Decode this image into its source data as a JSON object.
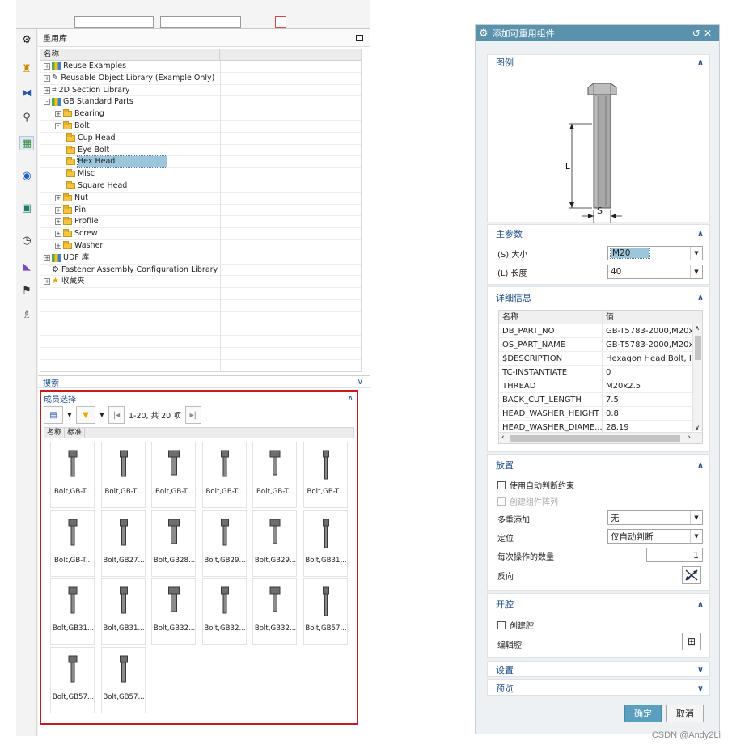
{
  "library": {
    "title": "重用库",
    "column_name": "名称",
    "tree": [
      {
        "label": "Reuse Examples",
        "level": 0,
        "expander": "+",
        "icon": "library-icon"
      },
      {
        "label": "Reusable Object Library (Example Only)",
        "level": 0,
        "expander": "+",
        "icon": "reusable-object-icon"
      },
      {
        "label": "2D Section Library",
        "level": 0,
        "expander": "+",
        "icon": "section-icon"
      },
      {
        "label": "GB Standard Parts",
        "level": 0,
        "expander": "-",
        "icon": "library-icon"
      },
      {
        "label": "Bearing",
        "level": 1,
        "expander": "+",
        "icon": "folder-icon"
      },
      {
        "label": "Bolt",
        "level": 1,
        "expander": "-",
        "icon": "folder-icon"
      },
      {
        "label": "Cup Head",
        "level": 2,
        "expander": "",
        "icon": "folder-icon"
      },
      {
        "label": "Eye Bolt",
        "level": 2,
        "expander": "",
        "icon": "folder-icon"
      },
      {
        "label": "Hex Head",
        "level": 2,
        "expander": "",
        "icon": "folder-icon",
        "selected": true
      },
      {
        "label": "Misc",
        "level": 2,
        "expander": "",
        "icon": "folder-icon"
      },
      {
        "label": "Square Head",
        "level": 2,
        "expander": "",
        "icon": "folder-icon"
      },
      {
        "label": "Nut",
        "level": 1,
        "expander": "+",
        "icon": "folder-icon"
      },
      {
        "label": "Pin",
        "level": 1,
        "expander": "+",
        "icon": "folder-icon"
      },
      {
        "label": "Profile",
        "level": 1,
        "expander": "+",
        "icon": "folder-icon"
      },
      {
        "label": "Screw",
        "level": 1,
        "expander": "+",
        "icon": "folder-icon"
      },
      {
        "label": "Washer",
        "level": 1,
        "expander": "+",
        "icon": "folder-icon"
      },
      {
        "label": "UDF 库",
        "level": 0,
        "expander": "+",
        "icon": "library-icon"
      },
      {
        "label": "Fastener Assembly Configuration Library",
        "level": 0,
        "expander": "",
        "icon": "fastener-config-icon"
      },
      {
        "label": "收藏夹",
        "level": 0,
        "expander": "+",
        "icon": "star-icon"
      }
    ],
    "search_label": "搜索",
    "members_label": "成员选择",
    "pagination": "1-20, 共 20 项",
    "member_cols": [
      "名称",
      "标准"
    ],
    "members": [
      "Bolt,GB-T...",
      "Bolt,GB-T...",
      "Bolt,GB-T...",
      "Bolt,GB-T...",
      "Bolt,GB-T...",
      "Bolt,GB-T...",
      "Bolt,GB-T...",
      "Bolt,GB27...",
      "Bolt,GB28...",
      "Bolt,GB29...",
      "Bolt,GB29...",
      "Bolt,GB31...",
      "Bolt,GB31...",
      "Bolt,GB31...",
      "Bolt,GB32...",
      "Bolt,GB32...",
      "Bolt,GB32...",
      "Bolt,GB57...",
      "Bolt,GB57...",
      "Bolt,GB57..."
    ]
  },
  "dialog": {
    "title": "添加可重用组件",
    "legend": {
      "title": "图例",
      "label_L": "L",
      "label_S": "S"
    },
    "main_params": {
      "title": "主参数",
      "size_label": "(S) 大小",
      "size_value": "M20",
      "length_label": "(L) 长度",
      "length_value": "40"
    },
    "details": {
      "title": "详细信息",
      "col_name": "名称",
      "col_value": "值",
      "rows": [
        {
          "k": "DB_PART_NO",
          "v": "GB-T5783-2000,M20x"
        },
        {
          "k": "OS_PART_NAME",
          "v": "GB-T5783-2000,M20x"
        },
        {
          "k": "$DESCRIPTION",
          "v": "Hexagon Head Bolt, I"
        },
        {
          "k": "TC-INSTANTIATE",
          "v": "0"
        },
        {
          "k": "THREAD",
          "v": "M20x2.5"
        },
        {
          "k": "BACK_CUT_LENGTH",
          "v": "7.5"
        },
        {
          "k": "HEAD_WASHER_HEIGHT",
          "v": "0.8"
        },
        {
          "k": "HEAD_WASHER_DIAME...",
          "v": "28.19"
        }
      ]
    },
    "placement": {
      "title": "放置",
      "auto_constraint": "使用自动判断约束",
      "create_array": "创建组件阵列",
      "multi_add_label": "多重添加",
      "multi_add_value": "无",
      "position_label": "定位",
      "position_value": "仅自动判断",
      "count_label": "每次操作的数量",
      "count_value": "1",
      "reverse_label": "反向"
    },
    "pocket": {
      "title": "开腔",
      "create_pocket": "创建腔",
      "edit_pocket": "编辑腔"
    },
    "settings_title": "设置",
    "preview_title": "预览",
    "ok_label": "确定",
    "cancel_label": "取消"
  },
  "watermark": "CSDN @Andy2Li",
  "colors": {
    "title_bar": "#5a92ad",
    "section_text": "#1f4f8c",
    "highlight": "#9cc6dc",
    "frame_red": "#c8191f"
  }
}
